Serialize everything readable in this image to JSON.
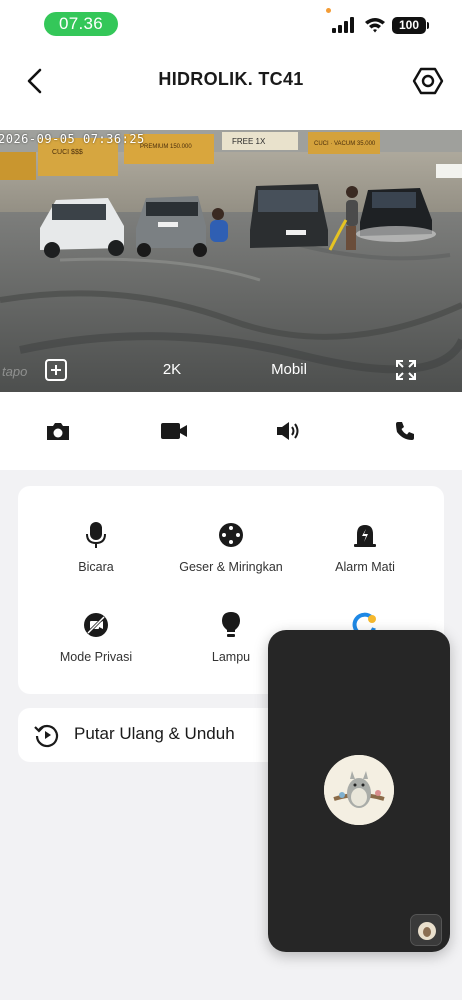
{
  "status_bar": {
    "time": "07.36",
    "battery": "100"
  },
  "header": {
    "title": "HIDROLIK. TC41"
  },
  "feed": {
    "timestamp": "2026-09-05 07:36:25",
    "watermark": "tapo",
    "resolution": "2K",
    "mode": "Mobil",
    "signs": [
      "CUCI $$$",
      "PREMIUM 150.000",
      "FREE 1X",
      "CUCI · VACUM 35.000"
    ]
  },
  "controls": [
    {
      "label": "Bicara",
      "icon": "microphone-icon"
    },
    {
      "label": "Geser & Miringkan",
      "icon": "pan-tilt-icon"
    },
    {
      "label": "Alarm Mati",
      "icon": "alarm-icon"
    },
    {
      "label": "Mode Privasi",
      "icon": "privacy-mode-icon"
    },
    {
      "label": "Lampu",
      "icon": "lightbulb-icon"
    }
  ],
  "playback": {
    "label": "Putar Ulang & Unduh",
    "icon": "replay-icon"
  },
  "colors": {
    "status_green": "#34c759",
    "accent_blue": "#1e88e5",
    "panel_bg": "#f2f2f4",
    "call_bg": "#262626"
  }
}
